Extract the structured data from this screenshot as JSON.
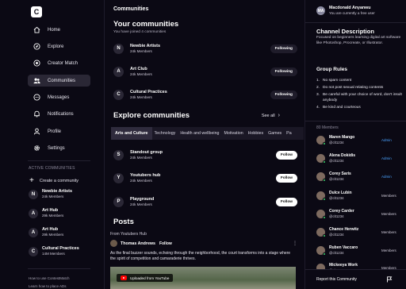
{
  "nav": {
    "logo_text": "C",
    "items": [
      {
        "label": "Home",
        "icon": "home-icon"
      },
      {
        "label": "Explore",
        "icon": "compass-icon"
      },
      {
        "label": "Creator Match",
        "icon": "match-icon"
      },
      {
        "label": "Communities",
        "icon": "users-icon"
      },
      {
        "label": "Messages",
        "icon": "message-icon"
      },
      {
        "label": "Notifications",
        "icon": "bell-icon"
      },
      {
        "label": "Profile",
        "icon": "person-icon"
      },
      {
        "label": "Settings",
        "icon": "gear-icon"
      }
    ],
    "active_index": 3,
    "active_heading": "ACTIVE COMMUNITIES",
    "create_label": "Create a community",
    "communities": [
      {
        "initial": "N",
        "name": "Newbie Artists",
        "members": "24k Members"
      },
      {
        "initial": "A",
        "name": "Art Hub",
        "members": "29k Members"
      },
      {
        "initial": "A",
        "name": "Art Hub",
        "members": "29k Members"
      },
      {
        "initial": "C",
        "name": "Cultural Practices",
        "members": "14M Members"
      }
    ],
    "footer_links": [
      "How to use ContestMatch",
      "Learn how to place ADs"
    ]
  },
  "main": {
    "page_title": "Communities",
    "your_title": "Your communities",
    "your_subtitle": "You have joined 4 communities",
    "joined": [
      {
        "initial": "N",
        "name": "Newbie Artists",
        "members": "24k Members",
        "action": "Following"
      },
      {
        "initial": "A",
        "name": "Art Club",
        "members": "24k Members",
        "action": "Following"
      },
      {
        "initial": "C",
        "name": "Cultural Practices",
        "members": "24k Members",
        "action": "Following"
      }
    ],
    "explore_title": "Explore communities",
    "see_all": "See all",
    "categories": [
      "Arts and Culture",
      "Technology",
      "Health and wellbeing",
      "Motivation",
      "Hobbies",
      "Games",
      "Pa"
    ],
    "active_category": 0,
    "suggested": [
      {
        "initial": "S",
        "name": "Standout group",
        "members": "24k Members",
        "action": "Follow"
      },
      {
        "initial": "Y",
        "name": "Youtubers hub",
        "members": "24k Members",
        "action": "Follow"
      },
      {
        "initial": "P",
        "name": "Playground",
        "members": "24k Members",
        "action": "Follow"
      }
    ],
    "posts_title": "Posts",
    "post": {
      "from": "From Youtubers Hub",
      "author": "Thomas Andrews",
      "follow": "Follow",
      "body": "As the final buzzer sounds, echoing through the neighborhood, the court transforms into a stage where the spirit of competition and camaraderie thrives.",
      "video_label": "Uploaded from YouTube"
    }
  },
  "right": {
    "owner_initials": "MA",
    "owner_name": "Macdonald Anyanwu",
    "owner_status": "You are currently a free user",
    "desc_title": "Channel Description",
    "description": "Focused on beginners learning digital art software like Photoshop, Procreate, or Illustrator.",
    "rules_title": "Group Rules",
    "rules": [
      {
        "num": "1.",
        "text": "No spam content"
      },
      {
        "num": "2.",
        "text": "Do not post sexual relating contents"
      },
      {
        "num": "3.",
        "text": "Be careful with your choice of word, don't insult anybody"
      },
      {
        "num": "4.",
        "text": "Be kind and courteous"
      }
    ],
    "members_heading": "80 Members",
    "members": [
      {
        "name": "Maren Mango",
        "handle": "@clt1234",
        "role": "Admin",
        "role_type": "admin"
      },
      {
        "name": "Alena Dokidis",
        "handle": "@clt1234",
        "role": "Admin",
        "role_type": "admin"
      },
      {
        "name": "Corey Saris",
        "handle": "@clt1234",
        "role": "Admin",
        "role_type": "admin"
      },
      {
        "name": "Dulce Lubin",
        "handle": "@clt1234",
        "role": "Members",
        "role_type": "member"
      },
      {
        "name": "Corey Carder",
        "handle": "@clt1234",
        "role": "Members",
        "role_type": "member"
      },
      {
        "name": "Chance Herwitz",
        "handle": "@clt1234",
        "role": "Members",
        "role_type": "member"
      },
      {
        "name": "Ruben Vaccaro",
        "handle": "@clt1234",
        "role": "Members",
        "role_type": "member"
      },
      {
        "name": "Mickeeya Work",
        "handle": "@clt1234",
        "role": "Members",
        "role_type": "member"
      }
    ],
    "report_label": "Report this Community",
    "colors": {
      "admin": "#4aa3ff",
      "online": "#3ad26b"
    }
  }
}
